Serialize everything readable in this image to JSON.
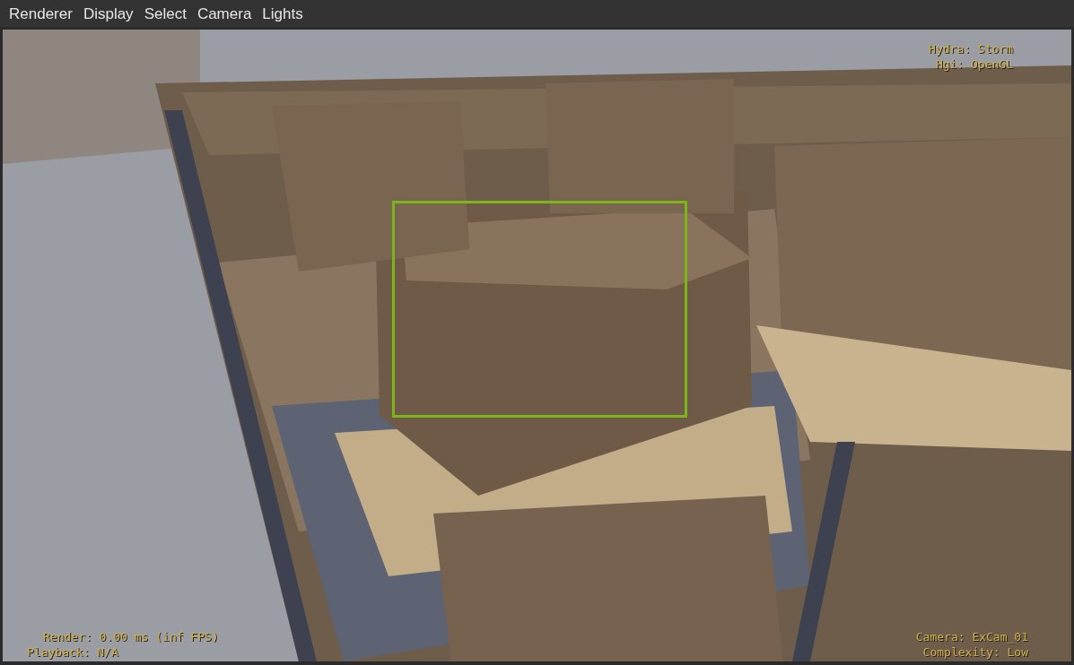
{
  "menu_bar": [
    {
      "label": "Renderer"
    },
    {
      "label": "Display"
    },
    {
      "label": "Select"
    },
    {
      "label": "Camera"
    },
    {
      "label": "Lights"
    }
  ],
  "viewport": {
    "kind": "picture",
    "hud_top_right": [
      "Hydra: Storm",
      "Hgi: OpenGL"
    ],
    "hud_bottom_left": [
      "Render: 0.00 ms (inf FPS)",
      "Playback: N/A"
    ],
    "hud_bottom_right": [
      "Camera: ExCam_01",
      "Complexity: Low"
    ]
  }
}
